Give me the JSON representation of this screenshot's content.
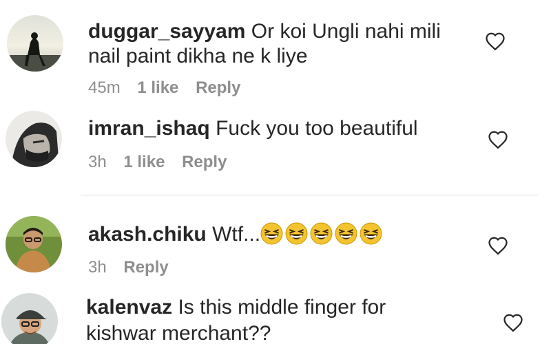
{
  "comments": [
    {
      "username": "duggar_sayyam",
      "text_line1": "Or koi Ungli nahi mili",
      "text_line2": "nail paint dikha ne k liye",
      "time": "45m",
      "likes": "1 like",
      "reply": "Reply",
      "avatar_icon": "silhouette-avatar",
      "like_icon": "heart-outline-icon"
    },
    {
      "username": "imran_ishaq",
      "text_line1": "Fuck you too beautiful",
      "time": "3h",
      "likes": "1 like",
      "reply": "Reply",
      "avatar_icon": "bearded-profile-avatar",
      "like_icon": "heart-outline-icon"
    },
    {
      "username": "akash.chiku",
      "text_line1": "Wtf...",
      "emoji_icon": "grinning-squinting-face-emoji",
      "emoji_count": 5,
      "time": "3h",
      "reply": "Reply",
      "avatar_icon": "man-with-glasses-avatar",
      "like_icon": "heart-outline-icon"
    },
    {
      "username": "kalenvaz",
      "text_line1": "Is this middle finger for",
      "text_line2": "kishwar merchant??",
      "avatar_icon": "man-with-cap-avatar",
      "like_icon": "heart-outline-icon"
    }
  ],
  "colors": {
    "text": "#262626",
    "meta": "#8e8e8e",
    "divider": "#dbdbdb",
    "emoji": "#f4c430"
  }
}
